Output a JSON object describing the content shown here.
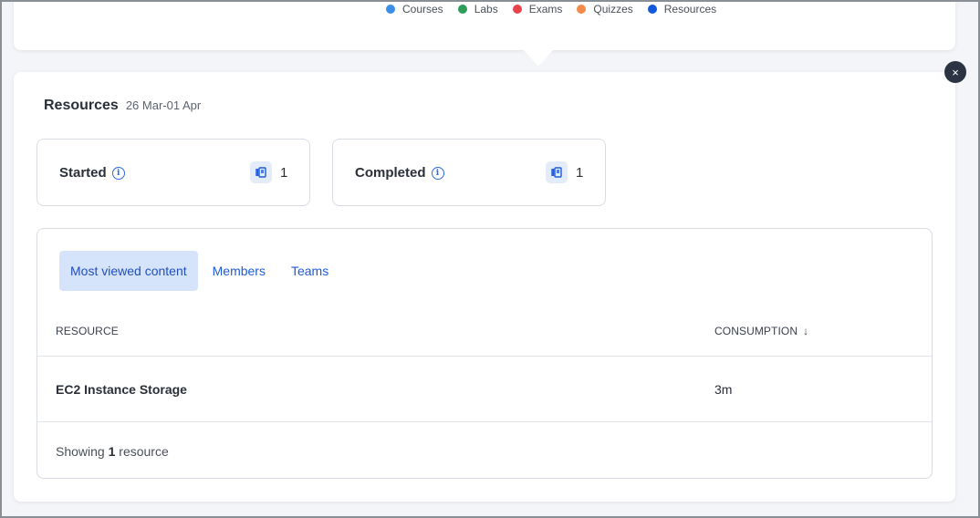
{
  "legend": [
    {
      "label": "Courses",
      "color": "#3a8fe8"
    },
    {
      "label": "Labs",
      "color": "#2c9e5a"
    },
    {
      "label": "Exams",
      "color": "#e8434b"
    },
    {
      "label": "Quizzes",
      "color": "#f48b4a"
    },
    {
      "label": "Resources",
      "color": "#1459d9"
    }
  ],
  "header": {
    "title": "Resources",
    "range": "26 Mar-01 Apr"
  },
  "stats": {
    "started": {
      "label": "Started",
      "value": "1"
    },
    "completed": {
      "label": "Completed",
      "value": "1"
    }
  },
  "tabs": [
    "Most viewed content",
    "Members",
    "Teams"
  ],
  "table": {
    "columns": [
      "RESOURCE",
      "CONSUMPTION"
    ],
    "sort_indicator": "↓",
    "rows": [
      {
        "resource": "EC2 Instance Storage",
        "consumption": "3m"
      }
    ]
  },
  "footer": {
    "prefix": "Showing",
    "count": "1",
    "suffix": "resource"
  },
  "close_label": "×"
}
